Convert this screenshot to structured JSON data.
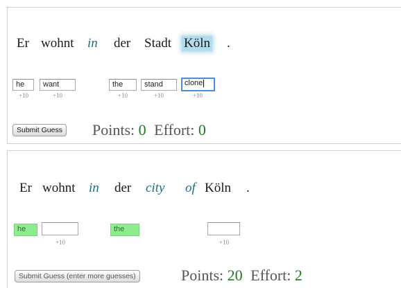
{
  "panel1": {
    "sentence": [
      "Er",
      "wohnt",
      "in",
      "der",
      "Stadt",
      "Köln",
      "."
    ],
    "guesses": [
      "he",
      "want",
      "",
      "the",
      "stand",
      "clone"
    ],
    "bonus": "+10",
    "submit_label": "Submit Guess",
    "points_label": "Points:",
    "points_value": "0",
    "effort_label": "Effort:",
    "effort_value": "0"
  },
  "panel2": {
    "sentence": [
      "Er",
      "wohnt",
      "in",
      "der",
      "city",
      "of",
      "Köln",
      "."
    ],
    "guesses": [
      "he",
      "",
      "",
      "the",
      "",
      ""
    ],
    "bonus": "+10",
    "submit_label": "Submit Guess (enter more guesses)",
    "points_label": "Points:",
    "points_value": "20",
    "effort_label": "Effort:",
    "effort_value": "2"
  },
  "colors": {
    "correct_guess": "#8fec8f",
    "score_number": "#1e7a1e",
    "italic_word": "#1f6b83",
    "highlight": "#b4dbea",
    "focus_border": "#4b8fd9"
  }
}
